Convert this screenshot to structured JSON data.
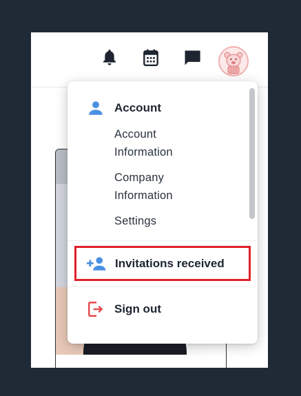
{
  "topbar": {
    "icons": [
      "bell-icon",
      "calendar-icon",
      "chat-icon"
    ],
    "avatar": "bear-avatar"
  },
  "menu": {
    "header_label": "Account",
    "header_icon": "person-icon",
    "items": [
      {
        "label_line1": "Account",
        "label_line2": "Information"
      },
      {
        "label_line1": "Company",
        "label_line2": "Information"
      },
      {
        "label_line1": "Settings"
      }
    ],
    "invitations_label": "Invitations received",
    "invitations_icon": "person-add-icon",
    "signout_label": "Sign out",
    "signout_icon": "sign-out-icon"
  },
  "colors": {
    "page_bg": "#1f2a36",
    "accent_blue": "#4a90e2",
    "highlight_red": "#e0202a",
    "signout_red": "#e5484d"
  }
}
